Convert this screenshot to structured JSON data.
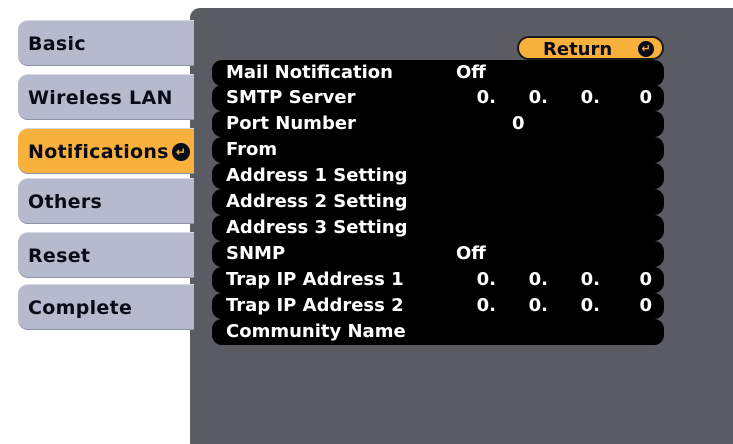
{
  "tabs": [
    {
      "label": "Basic"
    },
    {
      "label": "Wireless LAN"
    },
    {
      "label": "Notifications"
    },
    {
      "label": "Others"
    },
    {
      "label": "Reset"
    },
    {
      "label": "Complete"
    }
  ],
  "active_tab": "Notifications",
  "return_label": "Return",
  "enter_icon": "enter-icon",
  "settings": [
    {
      "label": "Mail Notification",
      "value": "Off"
    },
    {
      "label": "SMTP Server",
      "ip": [
        "0.",
        "0.",
        "0.",
        "0"
      ]
    },
    {
      "label": "Port Number",
      "value": "0"
    },
    {
      "label": "From",
      "value": ""
    },
    {
      "label": "Address 1 Setting",
      "value": ""
    },
    {
      "label": "Address 2 Setting",
      "value": ""
    },
    {
      "label": "Address 3 Setting",
      "value": ""
    },
    {
      "label": "SNMP",
      "value": "Off"
    },
    {
      "label": "Trap IP Address 1",
      "ip": [
        "0.",
        "0.",
        "0.",
        "0"
      ]
    },
    {
      "label": "Trap IP Address 2",
      "ip": [
        "0.",
        "0.",
        "0.",
        "0"
      ]
    },
    {
      "label": "Community Name",
      "value": ""
    }
  ],
  "colors": {
    "tab": "#b7b9cc",
    "active": "#f7b13c",
    "panel": "#5b5b63",
    "row": "#000000"
  }
}
